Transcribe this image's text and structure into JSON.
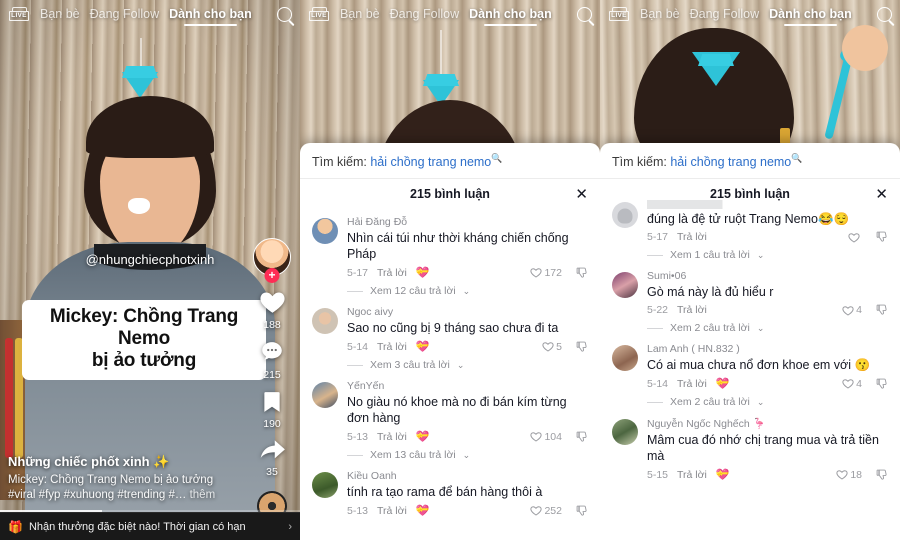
{
  "nav": {
    "live_label": "LIVE",
    "items": [
      {
        "label": "Bạn bè",
        "active": false
      },
      {
        "label": "Đang Follow",
        "active": false
      },
      {
        "label": "Dành cho bạn",
        "active": true
      }
    ],
    "search_icon": "search-icon"
  },
  "video": {
    "handle": "@nhungchiecphotxinh",
    "caption_line1": "Mickey: Chồng Trang Nemo",
    "caption_line2": "bị ảo tưởng",
    "author": "Những chiếc phốt xinh ✨",
    "description": "Mickey: Chồng Trang Nemo bị ảo tưởng",
    "hashtags": "#viral #fyp #xuhuong #trending #…",
    "more_label": "thêm",
    "actions": {
      "like_count": "188",
      "comment_count": "215",
      "bookmark_count": "190",
      "share_count": "35",
      "follow_plus": "+"
    },
    "banner_text": "Nhận thưởng đặc biệt nào! Thời gian có hạn",
    "banner_chevron": "chevron-right-icon"
  },
  "comment_sheet": {
    "search_label": "Tìm kiếm:",
    "search_query": "hải chồng trang nemo",
    "title": "215 bình luận",
    "close_icon": "close-icon",
    "reply_label": "Trả lời"
  },
  "comments_middle": [
    {
      "avatar": "a1",
      "name": "Hải Đăng Đỗ",
      "text": "Nhìn cái túi như thời kháng chiến chống Pháp",
      "date": "5-17",
      "reply": "Trả lời",
      "sticker": "💝",
      "likes": "172",
      "replies_label": "Xem 12 câu trả lời"
    },
    {
      "avatar": "a2",
      "name": "Ngoc aivy",
      "text": "Sao no cũng bị 9 tháng sao chưa đi ta",
      "date": "5-14",
      "reply": "Trả lời",
      "sticker": "💝",
      "likes": "5",
      "replies_label": "Xem 3 câu trả lời"
    },
    {
      "avatar": "a3",
      "name": "YếnYến",
      "text": "No giàu nó khoe mà no đi bán kím từng đơn hàng",
      "date": "5-13",
      "reply": "Trả lời",
      "sticker": "💝",
      "likes": "104",
      "replies_label": "Xem 13 câu trả lời"
    },
    {
      "avatar": "a4",
      "name": "Kiều Oanh",
      "text": "tính ra tạo rama để bán hàng thôi à",
      "date": "5-13",
      "reply": "Trả lời",
      "sticker": "💝",
      "likes": "252",
      "replies_label": ""
    }
  ],
  "comments_right": [
    {
      "avatar": "a5",
      "name": "",
      "text": "đúng là đệ tử ruột Trang Nemo😂😌",
      "date": "5-17",
      "reply": "Trả lời",
      "sticker": "",
      "likes": "",
      "replies_label": "Xem 1 câu trả lời"
    },
    {
      "avatar": "a6",
      "name": "Sumi•06",
      "text": "Gò má này là đủ hiểu r",
      "date": "5-22",
      "reply": "Trả lời",
      "sticker": "",
      "likes": "4",
      "replies_label": "Xem 2 câu trả lời"
    },
    {
      "avatar": "a7",
      "name": "Lam Anh ( HN.832 )",
      "text": "Có ai mua chưa nổ đơn khoe em với 😗",
      "date": "5-14",
      "reply": "Trả lời",
      "sticker": "💝",
      "likes": "4",
      "replies_label": "Xem 2 câu trả lời"
    },
    {
      "avatar": "a8",
      "name": "Nguyễn Ngốc Nghếch 🦩",
      "text": "Mâm cua đó nhớ chị trang mua và trả tiền mà",
      "date": "5-15",
      "reply": "Trả lời",
      "sticker": "💝",
      "likes": "18",
      "replies_label": ""
    }
  ],
  "colors": {
    "accent_red": "#fe2c55",
    "link_blue": "#2c6ec9",
    "text_dark": "#161823",
    "text_muted": "#8a8b91",
    "gem_teal": "#2ec3d8"
  }
}
